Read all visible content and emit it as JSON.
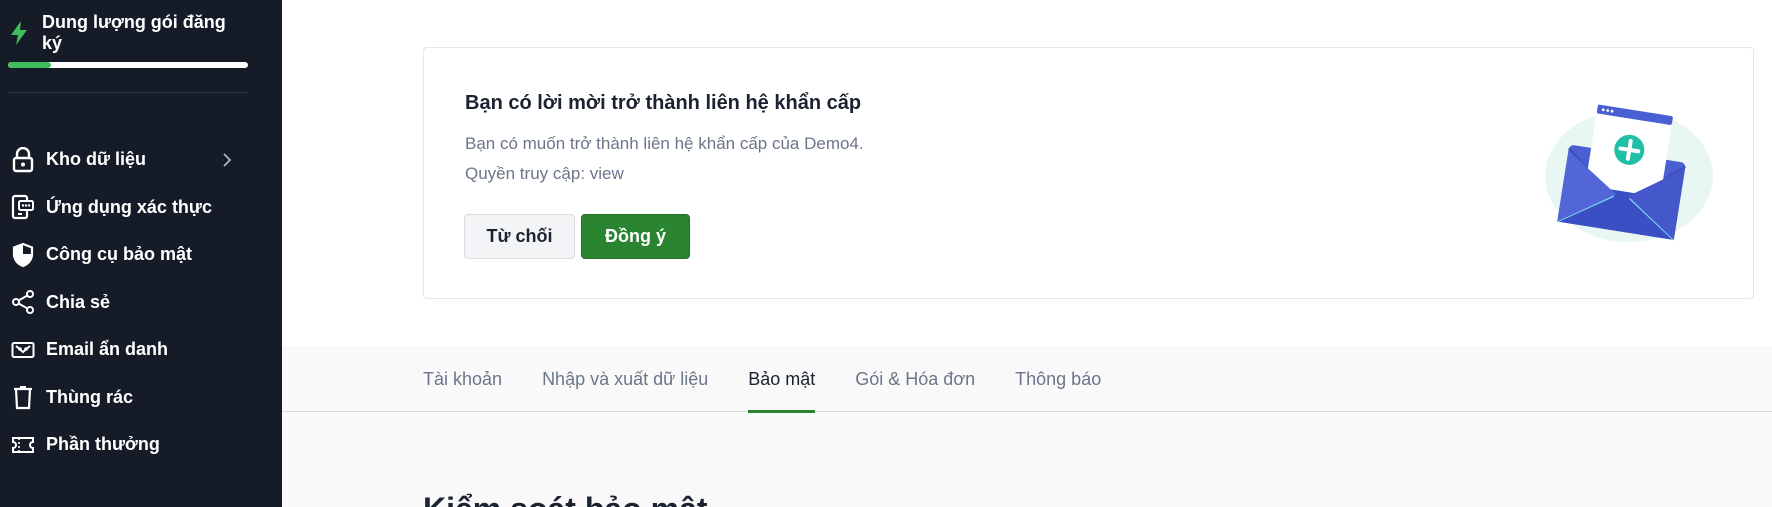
{
  "sidebar": {
    "plan": {
      "title": "Dung lượng gói đăng ký",
      "usage_fraction": 0.18,
      "icon": "bolt-icon",
      "accent": "#3fbf5a"
    },
    "items": [
      {
        "label": "Kho dữ liệu",
        "icon": "lock-icon",
        "has_chevron": true
      },
      {
        "label": "Ứng dụng xác thực",
        "icon": "authenticator-icon"
      },
      {
        "label": "Công cụ bảo mật",
        "icon": "shield-icon"
      },
      {
        "label": "Chia sẻ",
        "icon": "share-icon"
      },
      {
        "label": "Email ẩn danh",
        "icon": "masked-email-icon"
      },
      {
        "label": "Thùng rác",
        "icon": "trash-icon"
      },
      {
        "label": "Phần thưởng",
        "icon": "ticket-icon"
      }
    ]
  },
  "invite": {
    "title": "Bạn có lời mời trở thành liên hệ khẩn cấp",
    "description": "Bạn có muốn trở thành liên hệ khẩn cấp của Demo4.",
    "access": "Quyền truy cập: view",
    "decline_label": "Từ chối",
    "accept_label": "Đồng ý",
    "illustration": "envelope-plus-icon"
  },
  "tabs": [
    {
      "label": "Tài khoản",
      "active": false
    },
    {
      "label": "Nhập và xuất dữ liệu",
      "active": false
    },
    {
      "label": "Bảo mật",
      "active": true
    },
    {
      "label": "Gói & Hóa đơn",
      "active": false
    },
    {
      "label": "Thông báo",
      "active": false
    }
  ],
  "section": {
    "title": "Kiểm soát bảo mật"
  },
  "colors": {
    "sidebar_bg": "#161c27",
    "accent_green": "#2a8430",
    "progress_green": "#3fbf5a",
    "illustration_blue": "#4a5fd1",
    "illustration_teal": "#1fbfa8"
  }
}
